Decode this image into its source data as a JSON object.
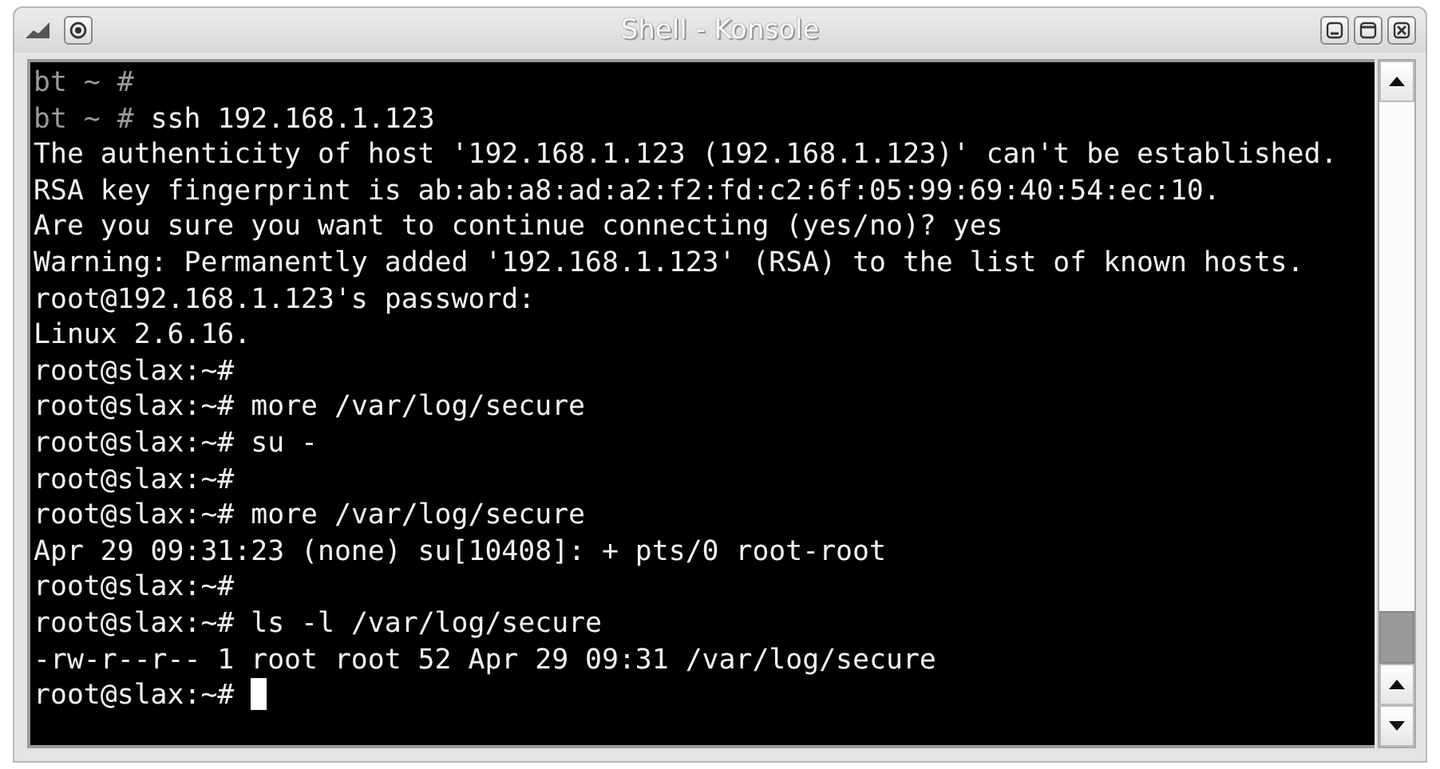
{
  "window": {
    "title": "Shell - Konsole"
  },
  "terminal": {
    "lines": [
      {
        "kind": "bt-prompt",
        "prompt": "bt ~ #"
      },
      {
        "kind": "bt-prompt",
        "prompt": "bt ~ #",
        "command": "ssh 192.168.1.123"
      },
      {
        "kind": "output",
        "text": "The authenticity of host '192.168.1.123 (192.168.1.123)' can't be established."
      },
      {
        "kind": "output",
        "text": "RSA key fingerprint is ab:ab:a8:ad:a2:f2:fd:c2:6f:05:99:69:40:54:ec:10."
      },
      {
        "kind": "output",
        "text": "Are you sure you want to continue connecting (yes/no)? yes"
      },
      {
        "kind": "output",
        "text": "Warning: Permanently added '192.168.1.123' (RSA) to the list of known hosts."
      },
      {
        "kind": "output",
        "text": "root@192.168.1.123's password:"
      },
      {
        "kind": "output",
        "text": "Linux 2.6.16."
      },
      {
        "kind": "root-prompt",
        "prompt": "root@slax:~#"
      },
      {
        "kind": "root-prompt",
        "prompt": "root@slax:~#",
        "command": "more /var/log/secure"
      },
      {
        "kind": "root-prompt",
        "prompt": "root@slax:~#",
        "command": "su -"
      },
      {
        "kind": "root-prompt",
        "prompt": "root@slax:~#"
      },
      {
        "kind": "root-prompt",
        "prompt": "root@slax:~#",
        "command": "more /var/log/secure"
      },
      {
        "kind": "output",
        "text": "Apr 29 09:31:23 (none) su[10408]: + pts/0 root-root"
      },
      {
        "kind": "root-prompt",
        "prompt": "root@slax:~#"
      },
      {
        "kind": "root-prompt",
        "prompt": "root@slax:~#",
        "command": "ls -l /var/log/secure"
      },
      {
        "kind": "output",
        "text": "-rw-r--r-- 1 root root 52 Apr 29 09:31 /var/log/secure"
      },
      {
        "kind": "root-prompt",
        "prompt": "root@slax:~#",
        "cursor": true
      }
    ]
  }
}
